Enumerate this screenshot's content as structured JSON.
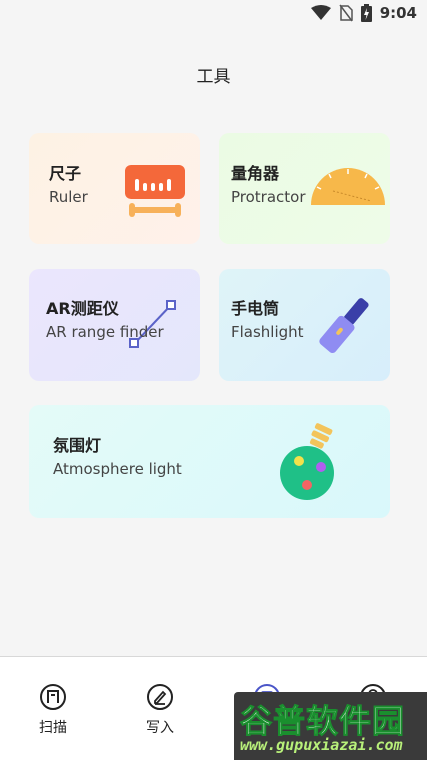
{
  "status_bar": {
    "time": "9:04"
  },
  "page_title": "工具",
  "tools": [
    {
      "name": "尺子",
      "subtitle": "Ruler",
      "icon": "ruler-icon"
    },
    {
      "name": "量角器",
      "subtitle": "Protractor",
      "icon": "protractor-icon"
    },
    {
      "name": "AR测距仪",
      "subtitle": "AR range finder",
      "icon": "ar-measure-icon"
    },
    {
      "name": "手电筒",
      "subtitle": "Flashlight",
      "icon": "flashlight-icon"
    },
    {
      "name": "氛围灯",
      "subtitle": "Atmosphere light",
      "icon": "bulb-icon"
    }
  ],
  "bottom_nav": [
    {
      "label": "扫描",
      "icon": "scan-icon"
    },
    {
      "label": "写入",
      "icon": "write-icon"
    },
    {
      "label": "",
      "icon": "tools-icon"
    },
    {
      "label": "",
      "icon": "profile-icon"
    }
  ],
  "watermark": {
    "logo": "谷普软件园",
    "url": "www.gupuxiazai.com"
  },
  "colors": {
    "ruler_accent": "#f4683a",
    "ruler_base": "#f7b15a",
    "protractor": "#f7b84a",
    "ar_line": "#5b63c8",
    "flashlight_body": "#8f8cf2",
    "flashlight_head": "#3a3fa8",
    "bulb_body": "#1fc087",
    "bulb_cap": "#f3c45b"
  }
}
